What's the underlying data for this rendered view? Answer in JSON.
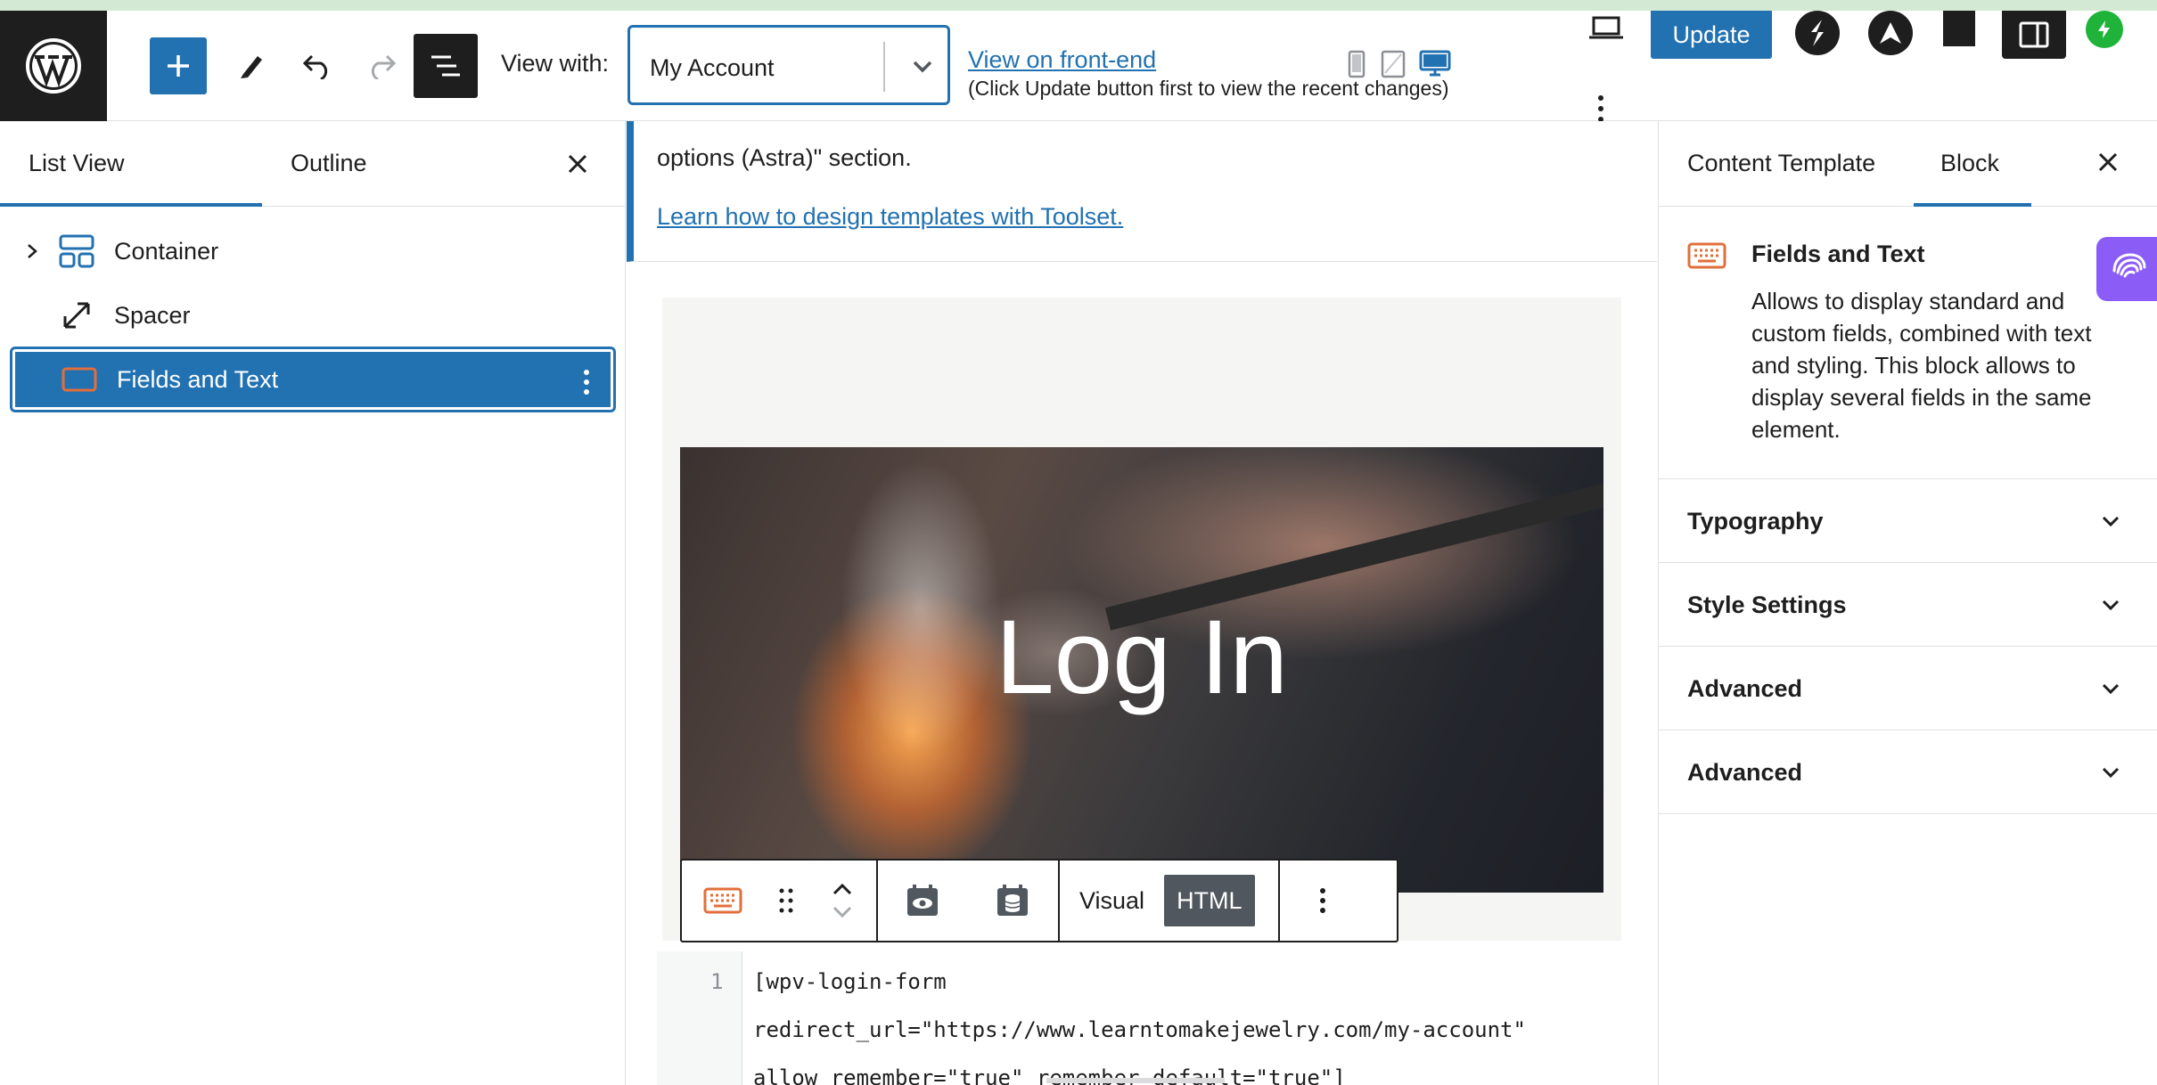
{
  "header": {
    "view_with_label": "View with:",
    "view_with_value": "My Account",
    "frontend_link": "View on front-end",
    "frontend_note": "(Click Update button first to view the recent changes)",
    "update_label": "Update"
  },
  "left_panel": {
    "tabs": [
      {
        "label": "List View",
        "active": true
      },
      {
        "label": "Outline",
        "active": false
      }
    ],
    "items": [
      {
        "label": "Container",
        "icon": "container-icon",
        "expandable": true,
        "selected": false
      },
      {
        "label": "Spacer",
        "icon": "spacer-icon",
        "expandable": false,
        "selected": false
      },
      {
        "label": "Fields and Text",
        "icon": "fields-text-icon",
        "expandable": false,
        "selected": true
      }
    ]
  },
  "canvas": {
    "notice_text": "options (Astra)\" section.",
    "notice_link": "Learn how to design templates with Toolset.",
    "hero_title": "Log In",
    "toolbar": {
      "visual_label": "Visual",
      "html_label": "HTML"
    },
    "code": {
      "line_number": "1",
      "lines": [
        "[wpv-login-form",
        "redirect_url=\"https://www.learntomakejewelry.com/my-account\"",
        "allow_remember=\"true\" remember_default=\"true\"]"
      ]
    }
  },
  "right_panel": {
    "tabs": [
      {
        "label": "Content Template",
        "active": false
      },
      {
        "label": "Block",
        "active": true
      }
    ],
    "block": {
      "name": "Fields and Text",
      "description": "Allows to display standard and custom fields, combined with text and styling. This block allows to display several fields in the same element."
    },
    "sections": [
      {
        "label": "Typography"
      },
      {
        "label": "Style Settings"
      },
      {
        "label": "Advanced"
      },
      {
        "label": "Advanced"
      }
    ]
  },
  "colors": {
    "accent": "#2271b1",
    "dark": "#1e1e1e",
    "block_icon": "#e26f3b",
    "ai_purple": "#8b5cf6",
    "green": "#1fb33a"
  }
}
